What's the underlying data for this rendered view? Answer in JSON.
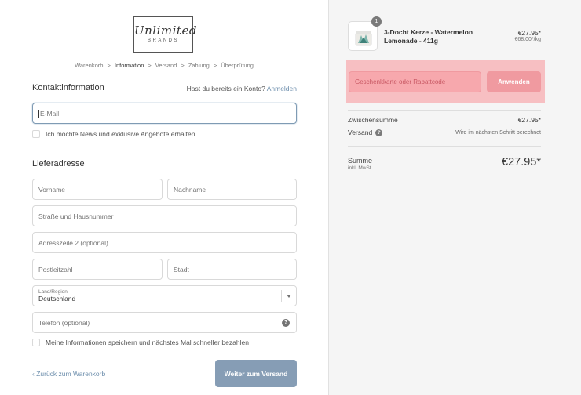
{
  "brand": {
    "script": "Unlimited",
    "wordmark": "BRANDS"
  },
  "breadcrumb": {
    "items": [
      "Warenkorb",
      "Information",
      "Versand",
      "Zahlung",
      "Überprüfung"
    ],
    "separator": ">"
  },
  "contact": {
    "title": "Kontaktinformation",
    "account_question": "Hast du bereits ein Konto?",
    "login_link": "Anmelden",
    "email_placeholder": "E-Mail",
    "newsletter_label": "Ich möchte News und exklusive Angebote erhalten"
  },
  "shipping": {
    "title": "Lieferadresse",
    "firstname_placeholder": "Vorname",
    "lastname_placeholder": "Nachname",
    "street_placeholder": "Straße und Hausnummer",
    "address2_placeholder": "Adresszeile 2 (optional)",
    "zip_placeholder": "Postleitzahl",
    "city_placeholder": "Stadt",
    "country_label": "Land/Region",
    "country_value": "Deutschland",
    "phone_placeholder": "Telefon (optional)",
    "help_glyph": "?",
    "save_info_label": "Meine Informationen speichern und nächstes Mal schneller bezahlen"
  },
  "footer": {
    "back_link": "‹ Zurück zum Warenkorb",
    "continue_button": "Weiter zum Versand"
  },
  "order": {
    "product": {
      "quantity": "1",
      "name": "3-Docht Kerze - Watermelon Lemonade - 411g",
      "price": "€27.95*",
      "unit_price": "€68.00*/kg"
    },
    "discount": {
      "placeholder": "Geschenkkarte oder Rabattcode",
      "apply": "Anwenden"
    },
    "subtotal_label": "Zwischensumme",
    "subtotal_value": "€27.95*",
    "shipping_label": "Versand",
    "shipping_help": "?",
    "shipping_value": "Wird im nächsten Schritt berechnet",
    "total_label": "Summe",
    "total_note": "inkl. MwSt.",
    "total_value": "€27.95*"
  },
  "colors": {
    "accent": "#869db5",
    "link": "#6e8fad",
    "highlight": "#f7bfc2"
  },
  "icons": [
    "chevron-right-icon",
    "chevron-down-icon",
    "question-icon",
    "checkbox-icon",
    "candle-icon"
  ]
}
